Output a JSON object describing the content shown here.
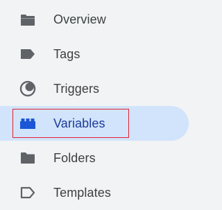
{
  "sidebar": {
    "items": [
      {
        "label": "Overview",
        "icon": "briefcase-icon",
        "active": false
      },
      {
        "label": "Tags",
        "icon": "tag-icon",
        "active": false
      },
      {
        "label": "Triggers",
        "icon": "trigger-icon",
        "active": false
      },
      {
        "label": "Variables",
        "icon": "lego-block-icon",
        "active": true
      },
      {
        "label": "Folders",
        "icon": "folder-icon",
        "active": false
      },
      {
        "label": "Templates",
        "icon": "template-icon",
        "active": false
      }
    ]
  },
  "colors": {
    "background": "#f1f3f4",
    "active_background": "#d2e3fc",
    "active_text": "#1a3c96",
    "icon_default": "#5f6368",
    "icon_active": "#1a56d6",
    "highlight_box": "#e0222b"
  }
}
